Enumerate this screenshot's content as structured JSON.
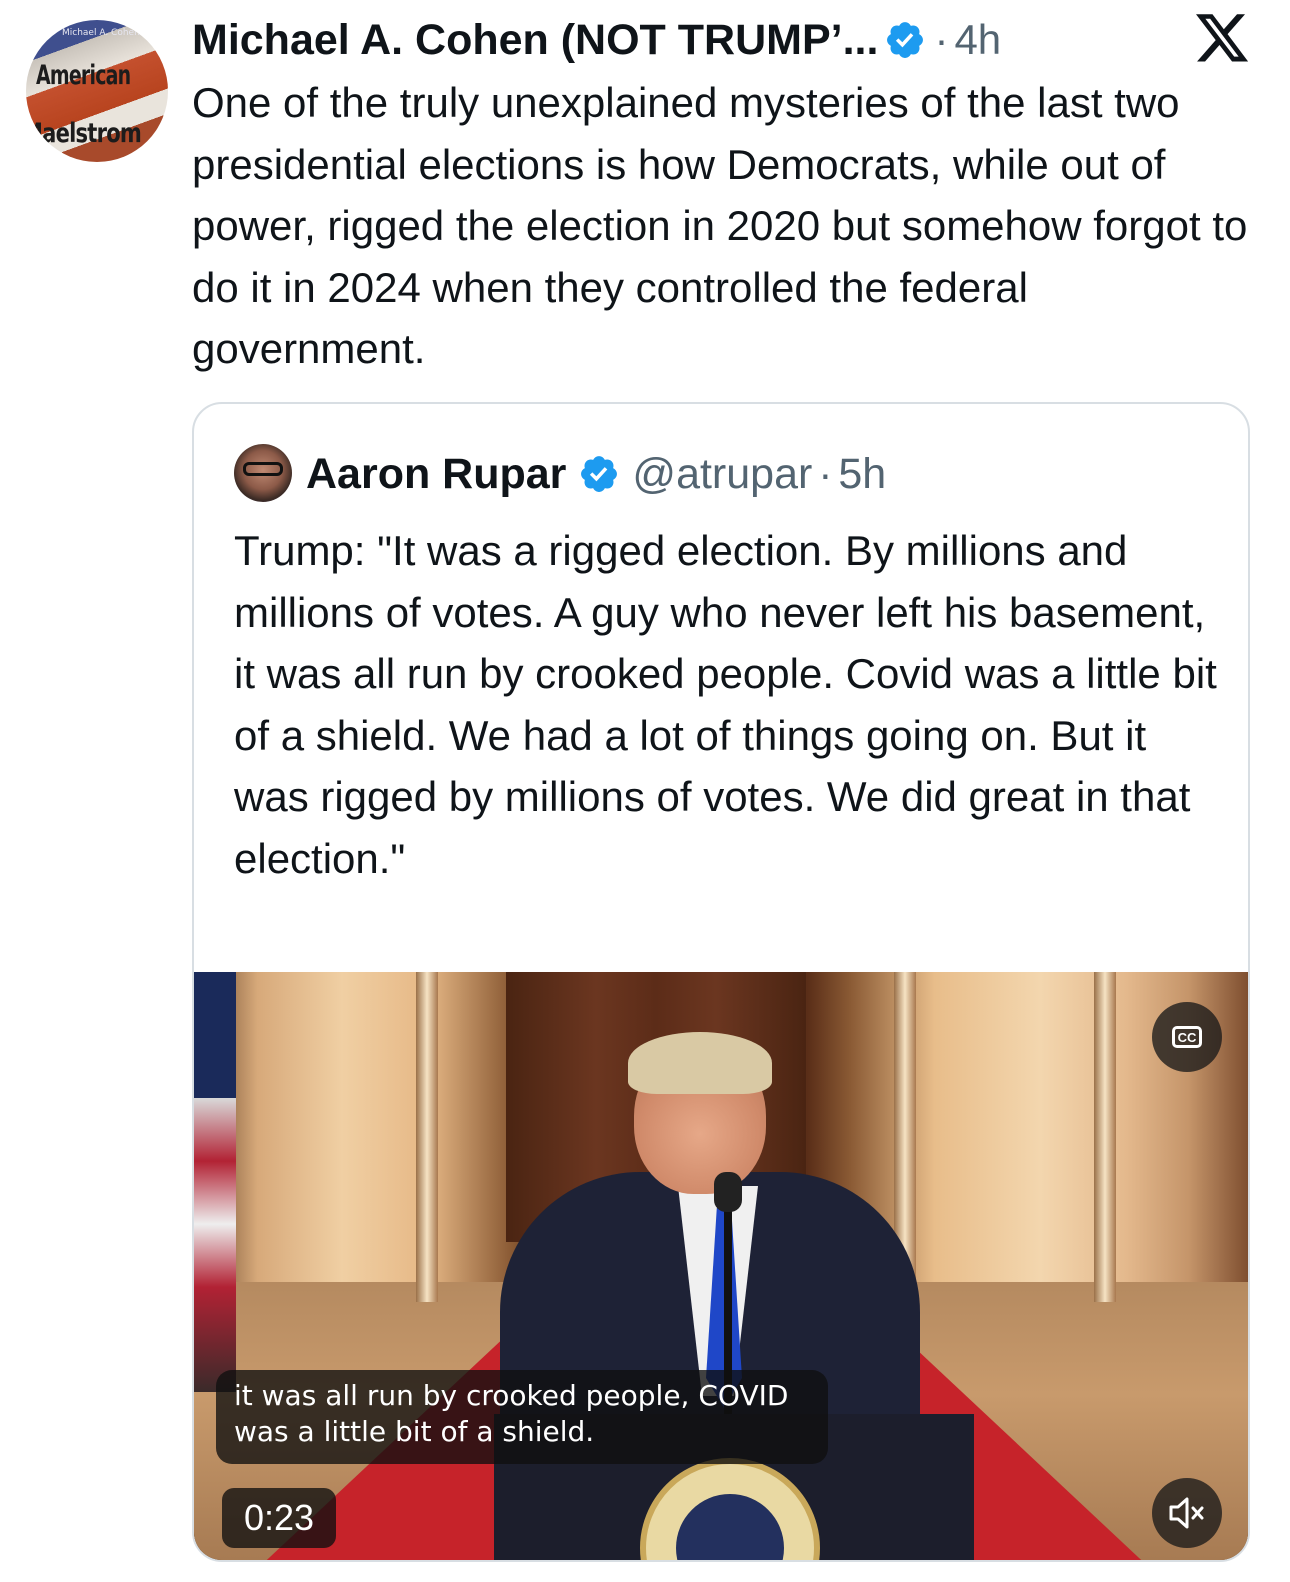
{
  "post": {
    "avatar": {
      "top_text": "Michael A. Cohen",
      "line1": "American",
      "line2": "Maelstrom"
    },
    "author_name": "Michael A. Cohen (NOT TRUMP’...",
    "separator": "·",
    "time": "4h",
    "text": "One of the truly unexplained mysteries of the last two presidential elections is how Democrats, while out of power, rigged the election in 2020 but somehow forgot to do it in 2024 when they controlled the federal government."
  },
  "quoted": {
    "name": "Aaron Rupar",
    "handle": "@atrupar",
    "separator": "·",
    "time": "5h",
    "text": "Trump: \"It was a rigged election. By millions and millions of votes. A guy who never left his basement, it was all run by crooked people. Covid was a little bit of a shield. We had a lot of things going on. But it was rigged by millions of votes. We did great in that election.\"",
    "video": {
      "caption": "it was all run by crooked people, COVID was a little bit of a shield.",
      "duration": "0:23",
      "cc_label": "CC"
    }
  },
  "colors": {
    "verified": "#1d9bf0",
    "text": "#0f1419",
    "secondary": "#536471",
    "border": "#d8dee3"
  },
  "icons": [
    "verified-badge-icon",
    "x-logo-icon",
    "closed-captions-icon",
    "mute-icon"
  ]
}
